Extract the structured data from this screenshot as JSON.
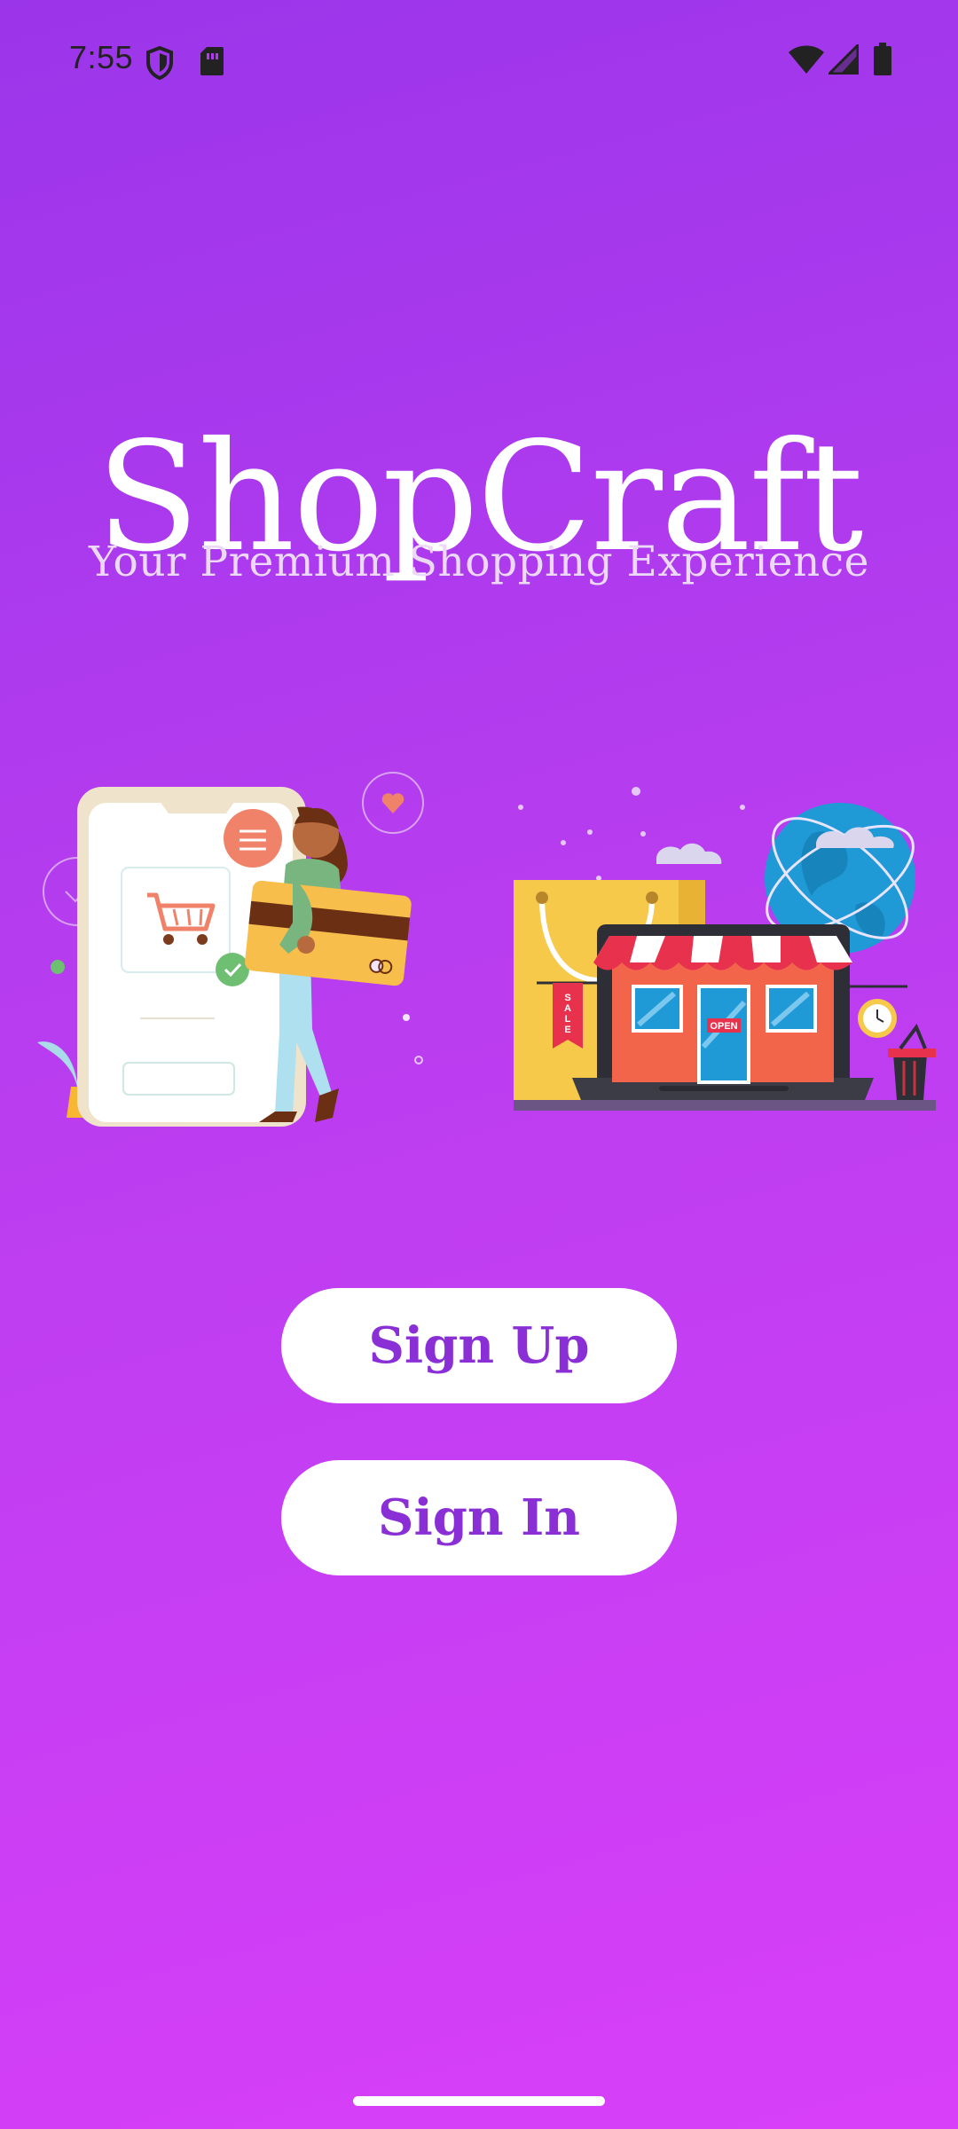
{
  "status_bar": {
    "time": "7:55",
    "icons": [
      "shield-icon",
      "sim-card-icon",
      "wifi-icon",
      "signal-icon",
      "battery-icon"
    ]
  },
  "app": {
    "title": "ShopCraft",
    "subtitle": "Your Premium Shopping Experience"
  },
  "illustrations": {
    "left_name": "mobile-shopping-illustration",
    "right_name": "online-store-illustration",
    "sale_text": "SALE",
    "open_text": "OPEN"
  },
  "buttons": {
    "sign_up": "Sign Up",
    "sign_in": "Sign In"
  },
  "colors": {
    "background_top": "#9b35ea",
    "background_bottom": "#d83ff8",
    "button_text": "#8a2fd6",
    "button_bg": "#ffffff"
  }
}
